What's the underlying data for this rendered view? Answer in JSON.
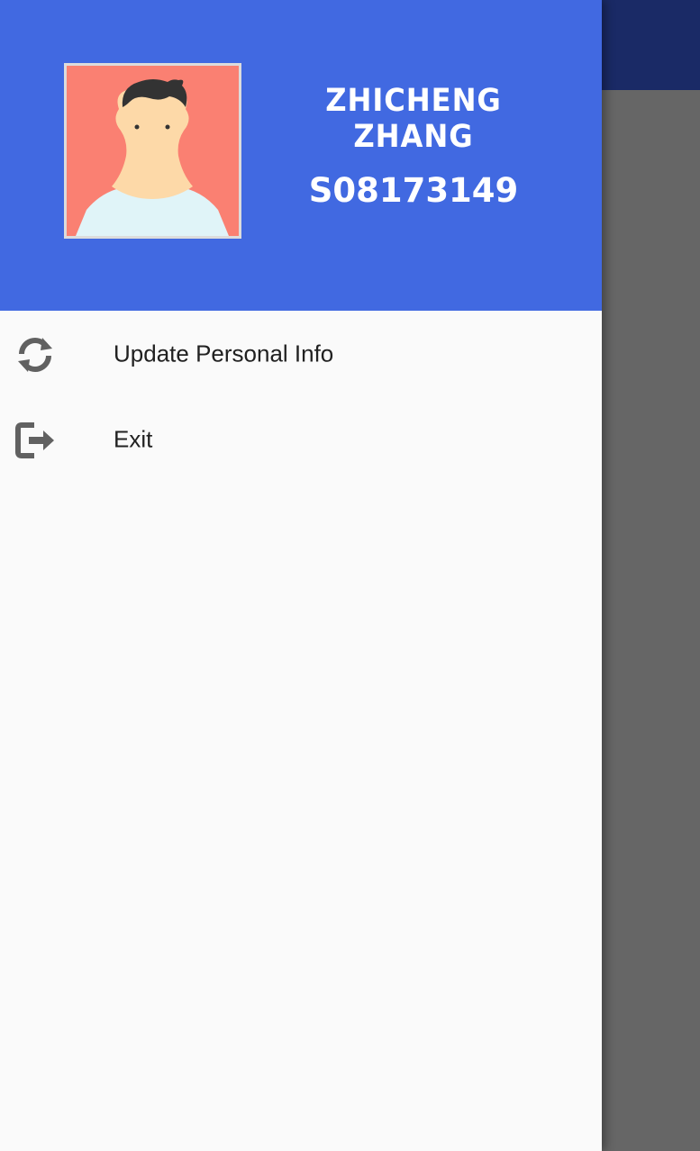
{
  "header": {
    "user_name": "Zhicheng Zhang",
    "user_id": "S08173149",
    "avatar_icon": "user-avatar-icon"
  },
  "menu": {
    "items": [
      {
        "label": "Update Personal Info",
        "icon": "sync-icon"
      },
      {
        "label": "Exit",
        "icon": "exit-icon"
      }
    ]
  },
  "colors": {
    "header_bg": "#4169e1",
    "drawer_bg": "#fafafa",
    "scrim": "#666666",
    "appbar_dark": "#1a2a66",
    "icon_gray": "#616161",
    "avatar_bg": "#fa8072"
  }
}
